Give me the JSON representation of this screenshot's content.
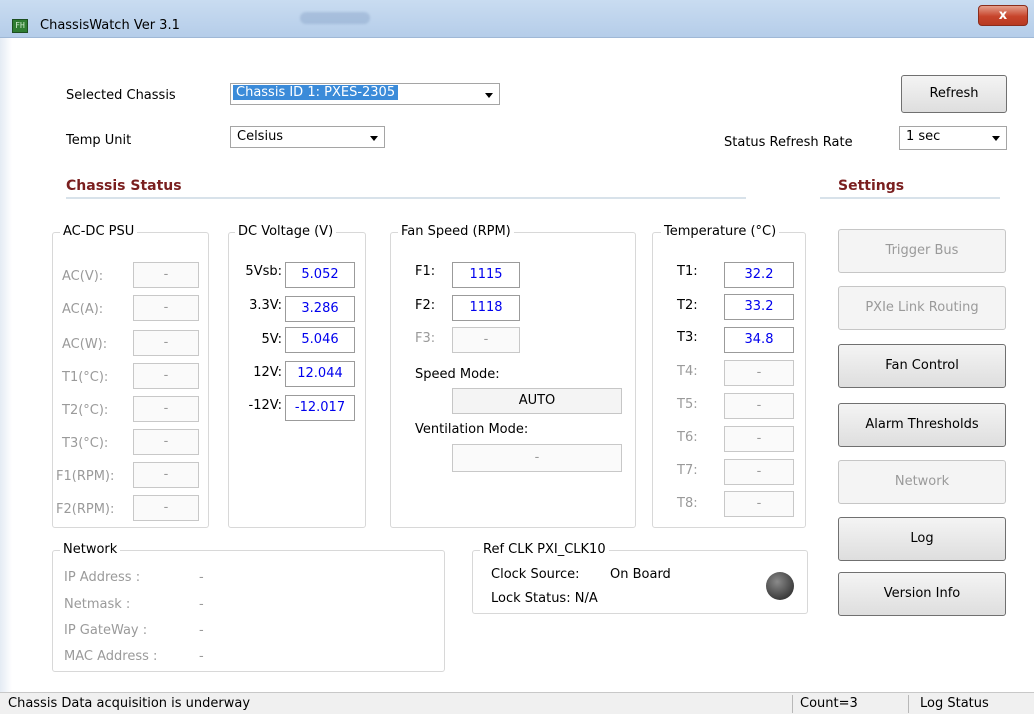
{
  "window": {
    "title": "ChassisWatch Ver 3.1",
    "close_label": "x",
    "icon_text": "FH"
  },
  "top": {
    "selected_chassis_label": "Selected Chassis",
    "selected_chassis_value": "Chassis ID 1: PXES-2305",
    "temp_unit_label": "Temp Unit",
    "temp_unit_value": "Celsius",
    "refresh_button": "Refresh",
    "status_refresh_rate_label": "Status Refresh Rate",
    "status_refresh_rate_value": "1 sec"
  },
  "headings": {
    "chassis_status": "Chassis Status",
    "settings": "Settings"
  },
  "ac_dc_psu": {
    "title": "AC-DC PSU",
    "rows": [
      {
        "label": "AC(V):",
        "value": "-"
      },
      {
        "label": "AC(A):",
        "value": "-"
      },
      {
        "label": "AC(W):",
        "value": "-"
      },
      {
        "label": "T1(°C):",
        "value": "-"
      },
      {
        "label": "T2(°C):",
        "value": "-"
      },
      {
        "label": "T3(°C):",
        "value": "-"
      },
      {
        "label": "F1(RPM):",
        "value": "-"
      },
      {
        "label": "F2(RPM):",
        "value": "-"
      }
    ]
  },
  "dc_voltage": {
    "title": "DC Voltage (V)",
    "rows": [
      {
        "label": "5Vsb:",
        "value": "5.052"
      },
      {
        "label": "3.3V:",
        "value": "3.286"
      },
      {
        "label": "5V:",
        "value": "5.046"
      },
      {
        "label": "12V:",
        "value": "12.044"
      },
      {
        "label": "-12V:",
        "value": "-12.017"
      }
    ]
  },
  "fan_speed": {
    "title": "Fan Speed (RPM)",
    "rows": [
      {
        "label": "F1:",
        "value": "1115"
      },
      {
        "label": "F2:",
        "value": "1118"
      },
      {
        "label": "F3:",
        "value": "-"
      }
    ],
    "speed_mode_label": "Speed Mode:",
    "speed_mode_value": "AUTO",
    "ventilation_mode_label": "Ventilation Mode:",
    "ventilation_mode_value": "-"
  },
  "temperature": {
    "title": "Temperature (°C)",
    "rows": [
      {
        "label": "T1:",
        "value": "32.2"
      },
      {
        "label": "T2:",
        "value": "33.2"
      },
      {
        "label": "T3:",
        "value": "34.8"
      },
      {
        "label": "T4:",
        "value": "-"
      },
      {
        "label": "T5:",
        "value": "-"
      },
      {
        "label": "T6:",
        "value": "-"
      },
      {
        "label": "T7:",
        "value": "-"
      },
      {
        "label": "T8:",
        "value": "-"
      }
    ]
  },
  "network": {
    "title": "Network",
    "rows": [
      {
        "label": "IP Address  :",
        "value": "-"
      },
      {
        "label": "Netmask     :",
        "value": "-"
      },
      {
        "label": "IP GateWay  :",
        "value": "-"
      },
      {
        "label": "MAC Address  :",
        "value": "-"
      }
    ]
  },
  "ref_clk": {
    "title": "Ref CLK PXI_CLK10",
    "clock_source_label": "Clock Source:",
    "clock_source_value": "On Board",
    "lock_status": "Lock Status: N/A"
  },
  "settings_buttons": {
    "trigger_bus": "Trigger Bus",
    "pxie_link_routing": "PXIe Link Routing",
    "fan_control": "Fan Control",
    "alarm_thresholds": "Alarm Thresholds",
    "network": "Network",
    "log": "Log",
    "version_info": "Version Info"
  },
  "statusbar": {
    "message": "Chassis Data acquisition is underway",
    "count": "Count=3",
    "log_status": "Log Status"
  },
  "colors": {
    "value_text": "#0000ee",
    "heading": "#7a1f1f",
    "disabled_text": "#9a9a9a"
  }
}
